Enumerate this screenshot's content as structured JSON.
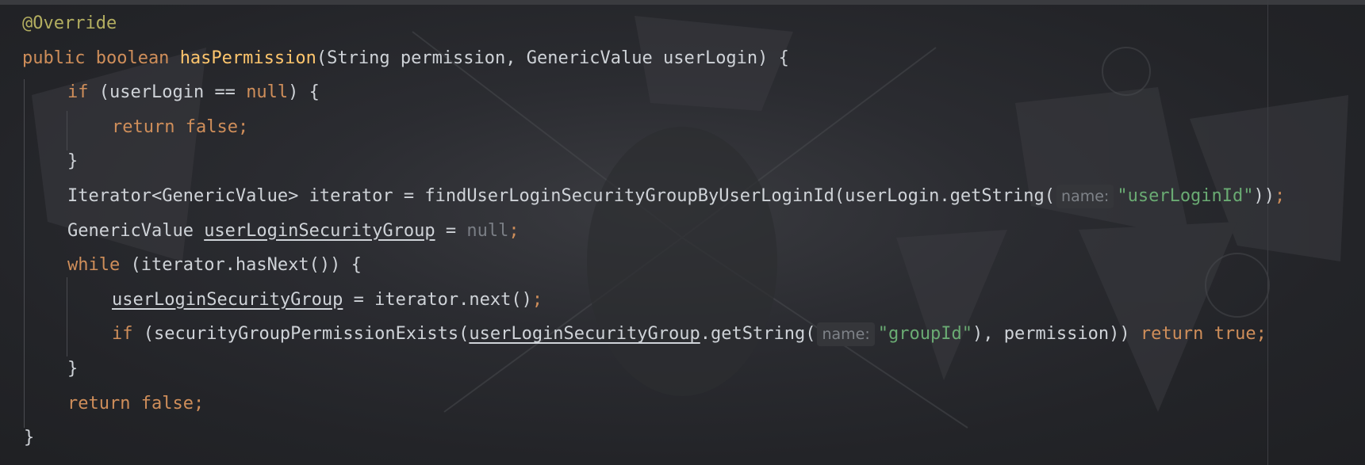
{
  "editor": {
    "lines": [
      {
        "t1": "@Override"
      },
      {
        "kw": "public boolean ",
        "fn": "hasPermission",
        "rest": "(String permission, GenericValue userLogin) {"
      },
      {
        "kw": "if",
        "a": " (userLogin == ",
        "null": "null",
        "b": ") {"
      },
      {
        "kw": "return false",
        "semi": ";"
      },
      {
        "t": "}"
      },
      {
        "a": "Iterator<GenericValue> iterator = findUserLoginSecurityGroupByUserLoginId(userLogin.getString(",
        "hint": "name:",
        "str": "\"userLoginId\"",
        "b": "))",
        "semi": ";"
      },
      {
        "a": "GenericValue ",
        "u": "userLoginSecurityGroup",
        "b": " = ",
        "null": "null",
        "semi": ";"
      },
      {
        "kw": "while",
        "a": " (iterator.hasNext()) {"
      },
      {
        "u": "userLoginSecurityGroup",
        "a": " = iterator.next()",
        "semi": ";"
      },
      {
        "kw": "if",
        "a": " (securityGroupPermissionExists(",
        "u": "userLoginSecurityGroup",
        "b": ".getString(",
        "hint": "name:",
        "str": "\"groupId\"",
        "c": "), permission)) ",
        "kw2": "return true",
        "semi": ";"
      },
      {
        "t": "}"
      },
      {
        "kw": "return false",
        "semi": ";"
      },
      {
        "t": "}"
      }
    ]
  }
}
